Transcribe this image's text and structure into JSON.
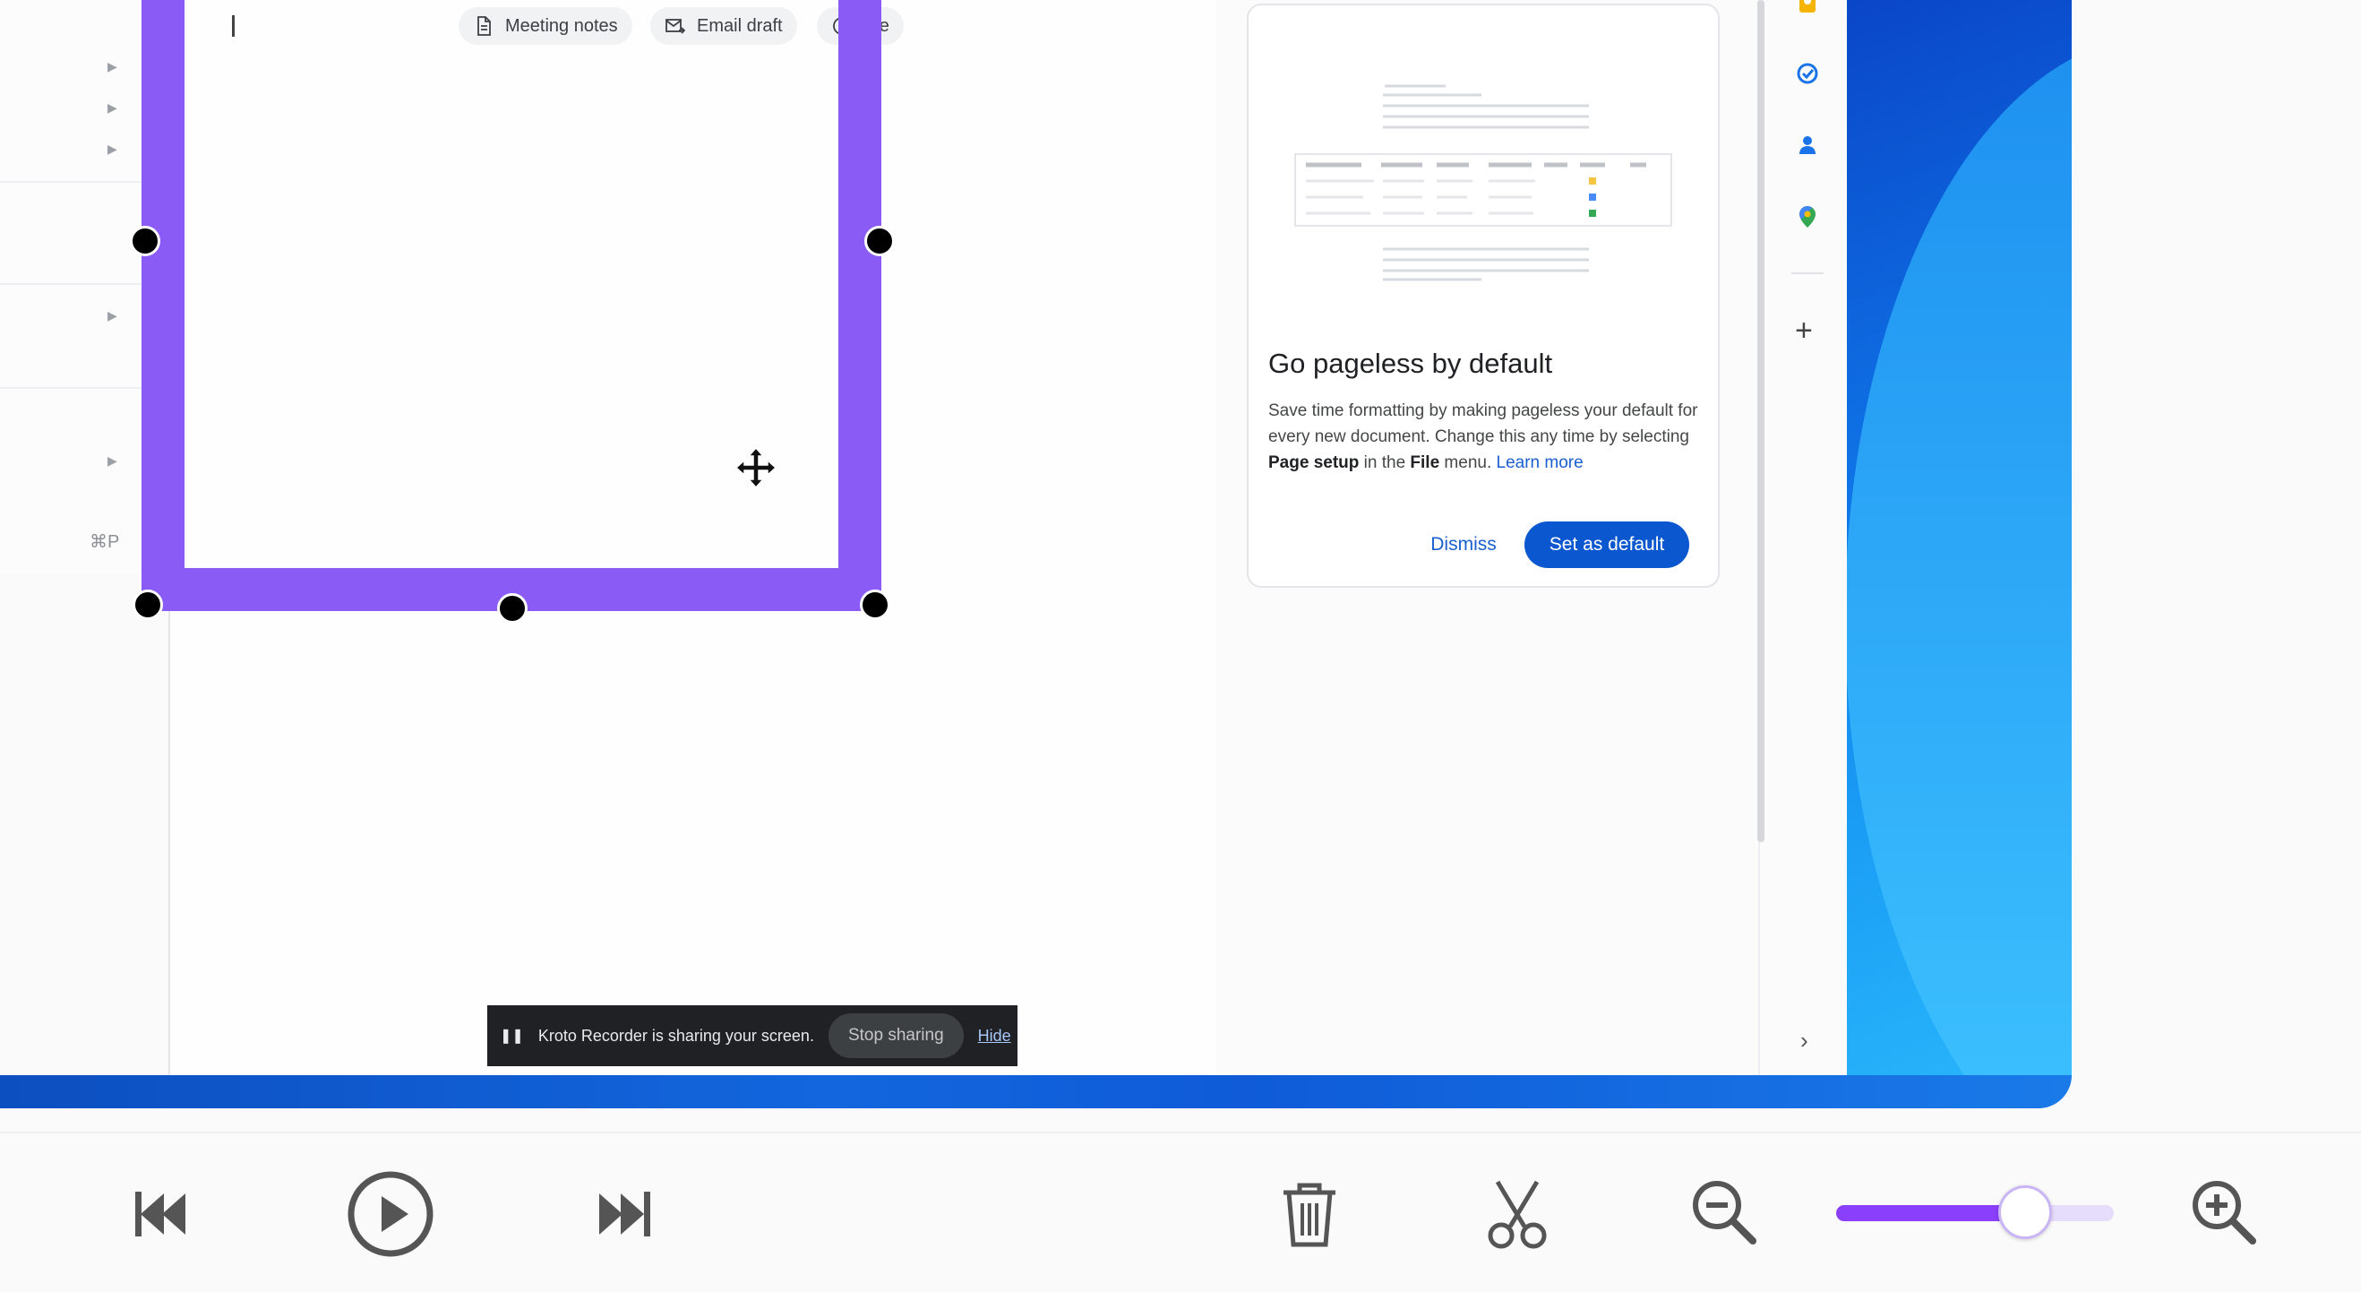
{
  "doc": {
    "chips": [
      {
        "label": "Meeting notes",
        "icon": "document-icon"
      },
      {
        "label": "Email draft",
        "icon": "email-icon"
      },
      {
        "label": "ore",
        "icon": "more-icon"
      }
    ],
    "menu_shortcut": "⌘P"
  },
  "card": {
    "title": "Go pageless by default",
    "body_part1": "Save time formatting by making pageless your default for every new document. Change this any time by selecting ",
    "body_bold1": "Page setup",
    "body_part2": " in the ",
    "body_bold2": "File",
    "body_part3": " menu. ",
    "learn_more": "Learn more",
    "dismiss_label": "Dismiss",
    "set_default_label": "Set as default"
  },
  "rail": {
    "icons": [
      "keep-icon",
      "tasks-icon",
      "contacts-icon",
      "maps-icon"
    ],
    "plus": "+",
    "chevron": "›"
  },
  "share_banner": {
    "message": "Kroto Recorder is sharing your screen.",
    "stop_label": "Stop sharing",
    "hide_label": "Hide"
  },
  "player": {
    "buttons": [
      "skip-back-icon",
      "play-icon",
      "skip-forward-icon",
      "trash-icon",
      "scissors-icon",
      "zoom-out-icon",
      "zoom-in-icon"
    ],
    "zoom_level": 0.68
  },
  "colors": {
    "selection": "#8a5cf5",
    "primary": "#0b57d0",
    "slider": "#8a3ffc"
  }
}
